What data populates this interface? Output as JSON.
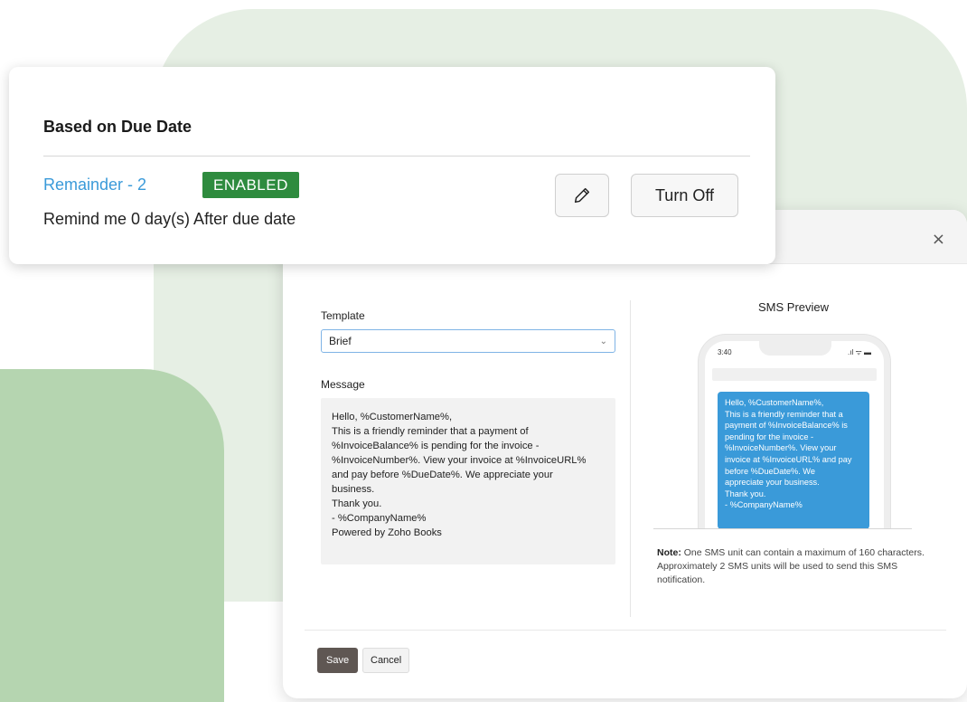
{
  "reminder_card": {
    "title": "Based on Due Date",
    "reminder_name": "Remainder - 2",
    "status_badge": "ENABLED",
    "description": "Remind me 0 day(s) After due date",
    "turn_off_label": "Turn Off",
    "edit_icon": "pencil-icon"
  },
  "modal": {
    "close_glyph": "×",
    "template_label": "Template",
    "template_value": "Brief",
    "message_label": "Message",
    "message_lines": [
      "Hello, %CustomerName%,",
      "This is a friendly reminder that a payment of",
      "%InvoiceBalance% is pending for the invoice -",
      "%InvoiceNumber%. View your invoice at %InvoiceURL%",
      "and pay before %DueDate%. We appreciate your",
      "business.",
      "Thank you.",
      "- %CompanyName%",
      "Powered by Zoho Books"
    ],
    "sms_preview_title": "SMS Preview",
    "phone_time": "3:40",
    "phone_status": ".ıl ᯤ ▬",
    "sms_lines": [
      "Hello, %CustomerName%,",
      "This is a friendly reminder that a",
      "payment of %InvoiceBalance% is",
      "pending for the invoice -",
      "%InvoiceNumber%. View your",
      "invoice at %InvoiceURL% and pay",
      "before %DueDate%. We",
      "appreciate your business.",
      "Thank you.",
      "- %CompanyName%"
    ],
    "note_label": "Note:",
    "note_text": " One SMS unit can contain a maximum of 160 characters. Approximately 2 SMS units will be used to send this SMS notification.",
    "save_label": "Save",
    "cancel_label": "Cancel"
  },
  "colors": {
    "accent_blue": "#3a9ad9",
    "badge_green": "#2e8b3e",
    "bg_green_light": "#e6efe4",
    "bg_green": "#b5d5b0",
    "save_button": "#5f5753"
  }
}
